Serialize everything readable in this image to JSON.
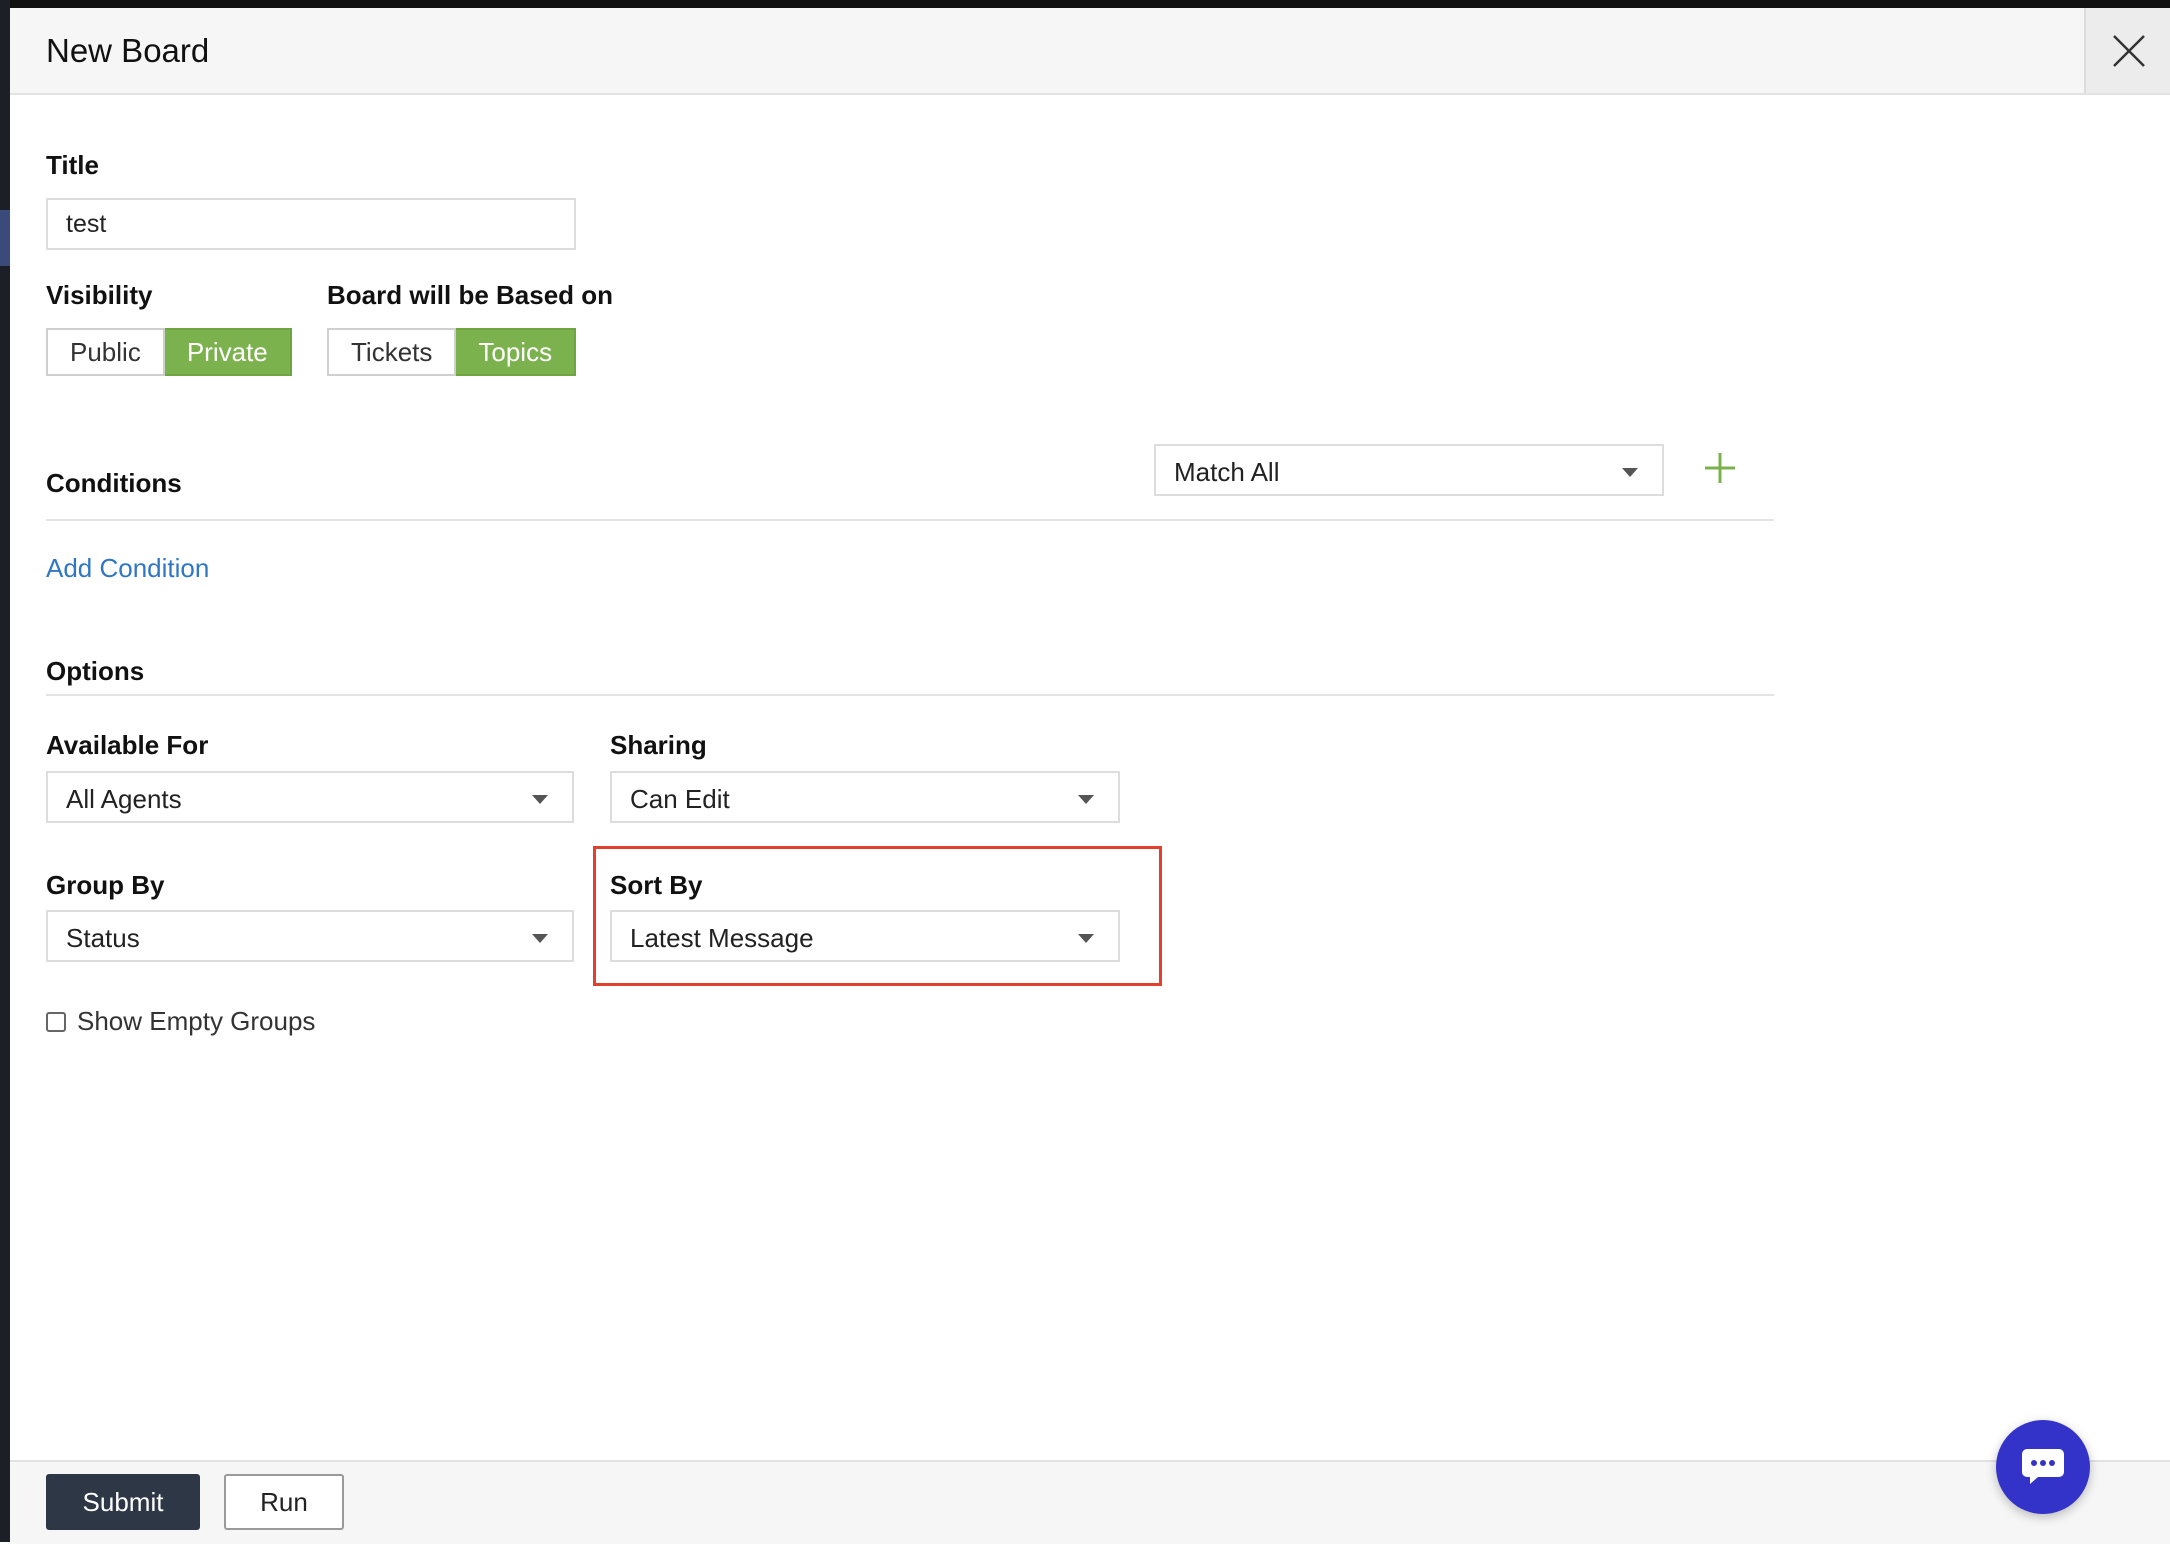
{
  "modal": {
    "title": "New Board"
  },
  "form": {
    "title_label": "Title",
    "title_value": "test",
    "visibility_label": "Visibility",
    "visibility_options": [
      "Public",
      "Private"
    ],
    "visibility_selected": "Private",
    "based_on_label": "Board will be Based on",
    "based_on_options": [
      "Tickets",
      "Topics"
    ],
    "based_on_selected": "Topics",
    "conditions_label": "Conditions",
    "match_value": "Match All",
    "add_condition_label": "Add Condition",
    "options_label": "Options",
    "available_for_label": "Available For",
    "available_for_value": "All Agents",
    "sharing_label": "Sharing",
    "sharing_value": "Can Edit",
    "group_by_label": "Group By",
    "group_by_value": "Status",
    "sort_by_label": "Sort By",
    "sort_by_value": "Latest Message",
    "show_empty_groups_label": "Show Empty Groups",
    "show_empty_groups_checked": false
  },
  "footer": {
    "submit_label": "Submit",
    "run_label": "Run"
  },
  "icons": {
    "close": "close-icon",
    "plus": "plus-icon",
    "caret": "chevron-down-icon",
    "chat": "chat-bubble-icon"
  },
  "colors": {
    "active_segment": "#7cb24e",
    "link": "#2f76c4",
    "primary_button": "#2d3746",
    "highlight_box": "#e2402c",
    "chat_button": "#3433c9",
    "plus_icon": "#7cb24e"
  }
}
